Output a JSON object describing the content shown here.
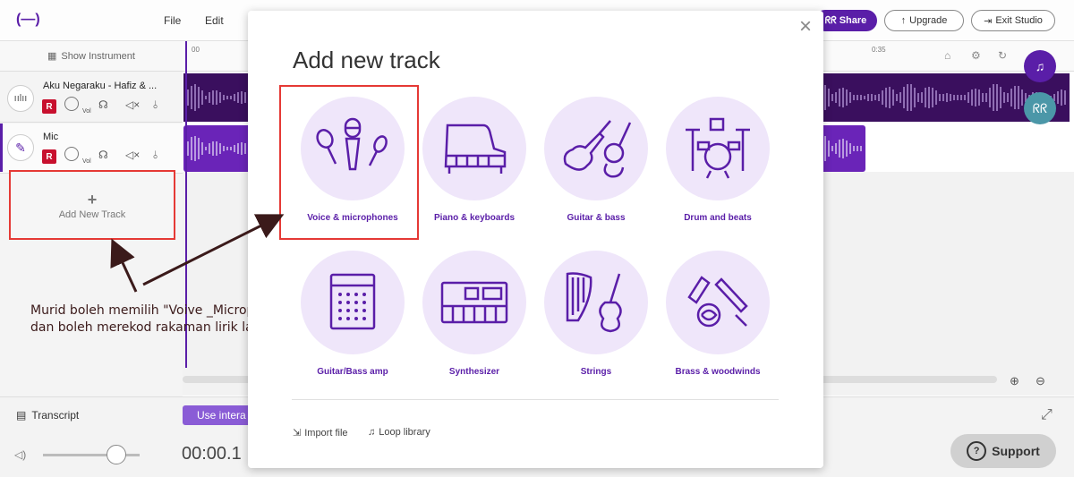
{
  "app": {
    "logo": "(—)",
    "menu": [
      "File",
      "Edit"
    ],
    "share_label": "Share",
    "upgrade_label": "Upgrade",
    "exit_label": "Exit Studio"
  },
  "left_panel": {
    "show_instrument": "Show Instrument",
    "tracks": [
      {
        "name": "Aku Negaraku - Hafiz & ...",
        "rec": "R",
        "vol": "Vol"
      },
      {
        "name": "Mic",
        "rec": "R",
        "vol": "Vol"
      }
    ],
    "add_track_plus": "+",
    "add_track_label": "Add New Track"
  },
  "timeline": {
    "marker_start": "00",
    "marker_end": "0:35"
  },
  "bottom": {
    "transcript": "Transcript",
    "use_inter": "Use intera",
    "timecode": "00:00.1",
    "support": "Support"
  },
  "annotation": {
    "line1": "Murid boleh memilih \"Voive _Microphones\"",
    "line2": "dan boleh merekod rakaman lirik lagu"
  },
  "modal": {
    "title": "Add new track",
    "close": "×",
    "tiles": [
      {
        "label": "Voice & microphones",
        "icon": "microphones-icon"
      },
      {
        "label": "Piano & keyboards",
        "icon": "piano-icon"
      },
      {
        "label": "Guitar & bass",
        "icon": "guitar-icon"
      },
      {
        "label": "Drum and beats",
        "icon": "drum-kit-icon"
      },
      {
        "label": "Guitar/Bass amp",
        "icon": "amp-icon"
      },
      {
        "label": "Synthesizer",
        "icon": "synthesizer-icon"
      },
      {
        "label": "Strings",
        "icon": "harp-cello-icon"
      },
      {
        "label": "Brass & woodwinds",
        "icon": "brass-icon"
      }
    ],
    "import_file": "Import file",
    "loop_library": "Loop library"
  },
  "colors": {
    "accent": "#5a1ea8",
    "tile_bg": "#efe6fa",
    "highlight": "#e53935"
  }
}
